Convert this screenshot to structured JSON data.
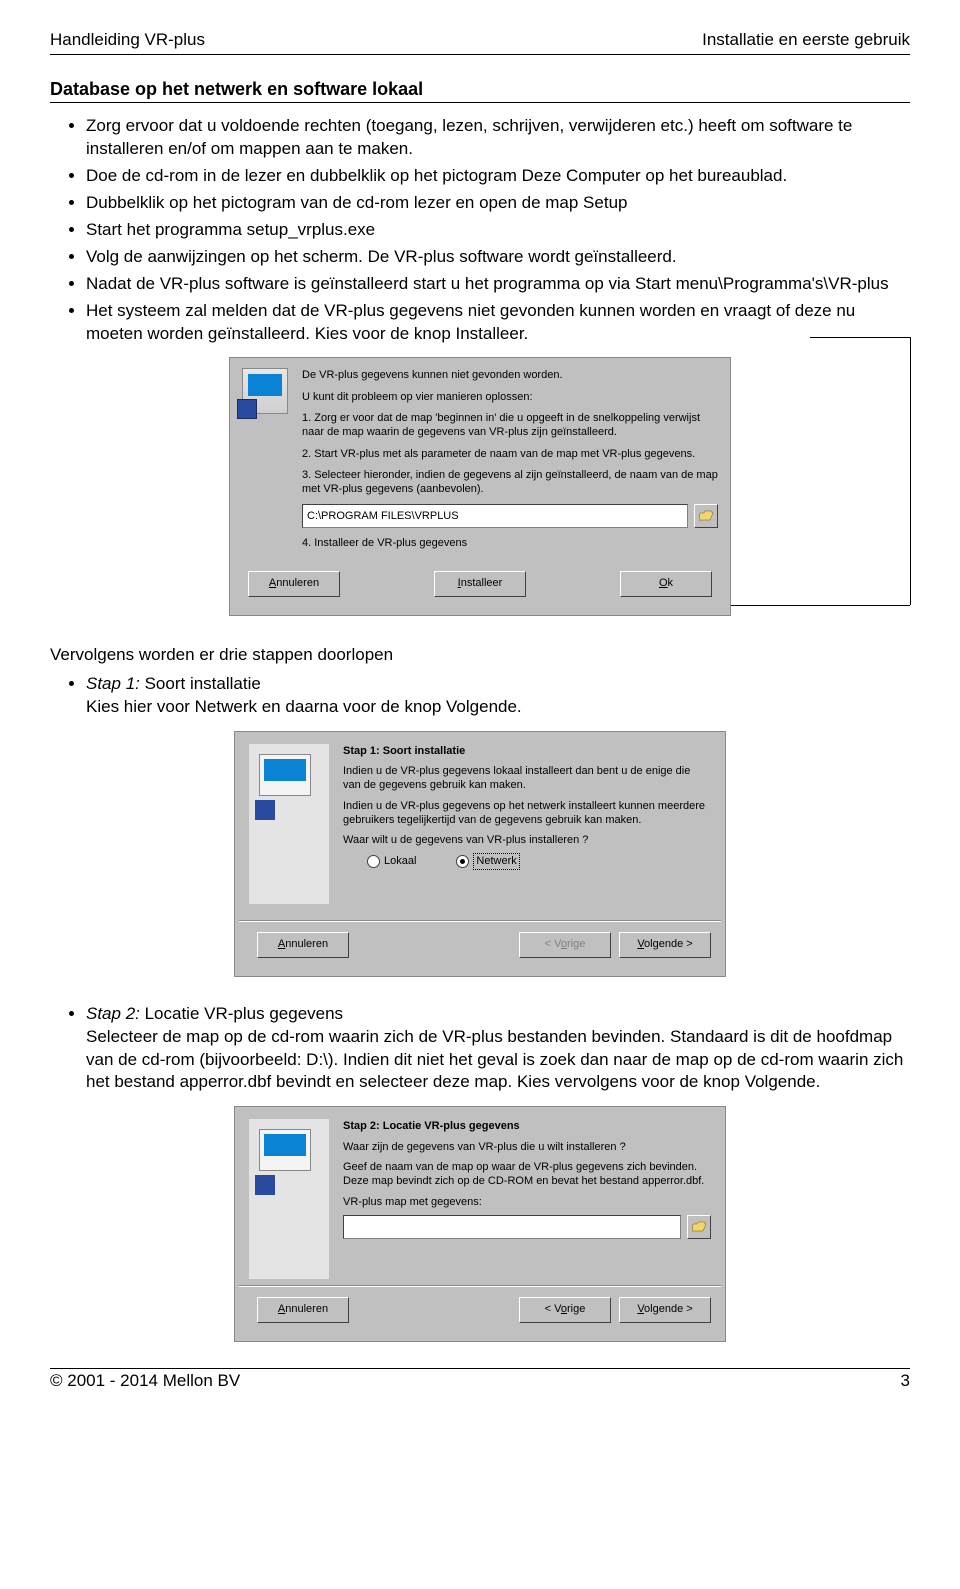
{
  "header": {
    "left": "Handleiding VR-plus",
    "right": "Installatie en eerste gebruik"
  },
  "section1": {
    "heading": "Database op het netwerk en software lokaal",
    "bullets": [
      "Zorg ervoor dat u voldoende rechten (toegang, lezen, schrijven, verwijderen etc.) heeft om software te installeren en/of om mappen aan te maken.",
      "Doe de cd-rom in de lezer en dubbelklik op het pictogram Deze Computer op het bureaublad.",
      "Dubbelklik op het pictogram van de cd-rom lezer en open de map Setup",
      "Start het programma setup_vrplus.exe",
      "Volg de aanwijzingen op het scherm. De VR-plus software wordt geïnstalleerd.",
      "Nadat de VR-plus software is geïnstalleerd start u het programma op via Start menu\\Programma's\\VR-plus",
      "Het systeem zal melden dat de VR-plus gegevens niet gevonden kunnen worden en vraagt of deze nu moeten worden geïnstalleerd. Kies voor de knop Installeer."
    ]
  },
  "dialog1": {
    "p1": "De VR-plus gegevens kunnen niet gevonden worden.",
    "p2": "U kunt dit probleem op vier manieren oplossen:",
    "p3": "1. Zorg er voor dat de map 'beginnen in' die u opgeeft in de snelkoppeling verwijst naar de map waarin de gegevens van VR-plus zijn geïnstalleerd.",
    "p4": "2. Start VR-plus met als parameter de naam van de map met VR-plus gegevens.",
    "p5": "3. Selecteer hieronder, indien de gegevens al zijn geïnstalleerd, de naam van de map met VR-plus gegevens (aanbevolen).",
    "path": "C:\\PROGRAM FILES\\VRPLUS",
    "p6": "4. Installeer de VR-plus gegevens",
    "btn_cancel": "Annuleren",
    "btn_install": "Installeer",
    "btn_ok": "Ok"
  },
  "para2": "Vervolgens worden er drie stappen doorlopen",
  "step1": {
    "bullet_title": "Stap 1:",
    "bullet_rest": " Soort installatie",
    "bullet_desc": "Kies hier voor Netwerk en daarna voor de knop Volgende."
  },
  "wizard1": {
    "title": "Stap 1: Soort installatie",
    "p1": "Indien u de VR-plus gegevens lokaal installeert dan bent u de enige die van de gegevens gebruik kan maken.",
    "p2": "Indien u de VR-plus gegevens op het netwerk installeert kunnen meerdere gebruikers tegelijkertijd van de gegevens gebruik kan maken.",
    "p3": "Waar wilt u de gegevens van VR-plus installeren ?",
    "radio_local": "Lokaal",
    "radio_network": "Netwerk",
    "btn_cancel": "Annuleren",
    "btn_prev": "< Vorige",
    "btn_next": "Volgende >"
  },
  "step2": {
    "bullet_title": "Stap 2:",
    "bullet_rest": " Locatie VR-plus gegevens",
    "desc": "Selecteer de map op de cd-rom waarin zich de VR-plus bestanden bevinden. Standaard is dit de hoofdmap van de cd-rom (bijvoorbeeld: D:\\). Indien dit niet het geval is zoek dan naar de map op de cd-rom waarin zich het bestand apperror.dbf bevindt en selecteer deze map. Kies vervolgens voor de knop Volgende."
  },
  "wizard2": {
    "title": "Stap 2: Locatie VR-plus gegevens",
    "p1": "Waar zijn de gegevens van VR-plus die u wilt installeren ?",
    "p2": "Geef de naam van de map op waar de VR-plus gegevens zich bevinden. Deze map bevindt zich op de CD-ROM en bevat het bestand apperror.dbf.",
    "label": "VR-plus map met gegevens:",
    "path": "",
    "btn_cancel": "Annuleren",
    "btn_prev": "< Vorige",
    "btn_next": "Volgende >"
  },
  "footer": {
    "left": "© 2001 - 2014 Mellon BV",
    "right": "3"
  }
}
